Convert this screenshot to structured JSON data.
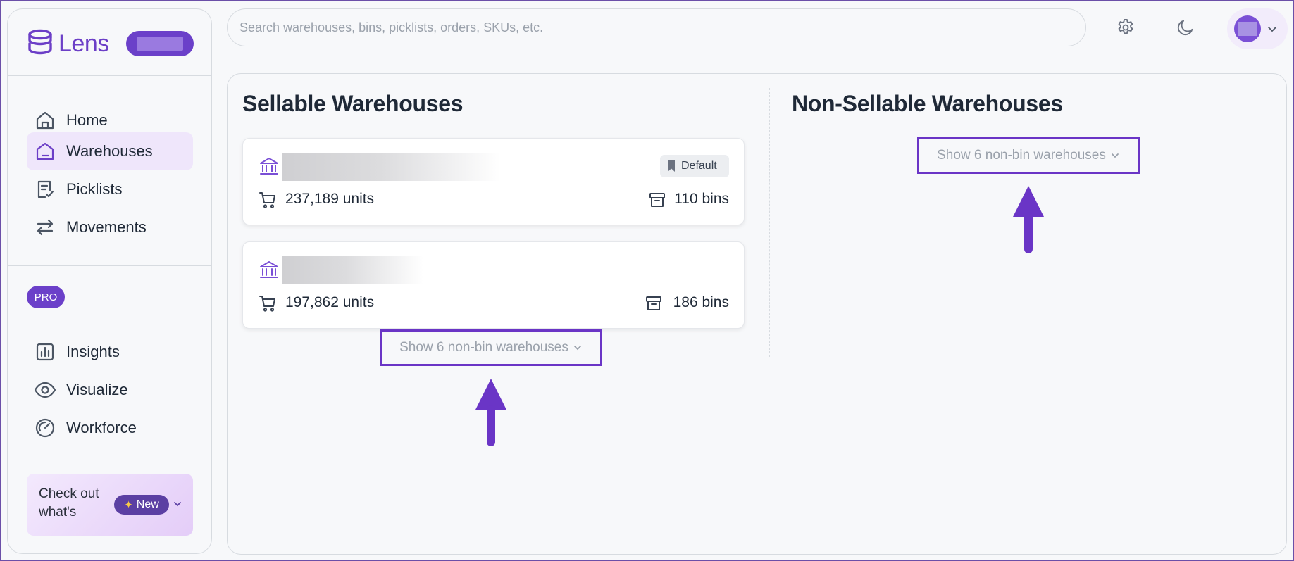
{
  "app": {
    "name": "Lens",
    "accent": "#6b40c9"
  },
  "sidebar": {
    "items": [
      {
        "label": "Home",
        "icon": "home-icon",
        "active": false
      },
      {
        "label": "Warehouses",
        "icon": "warehouse-icon",
        "active": true
      },
      {
        "label": "Picklists",
        "icon": "picklist-icon",
        "active": false
      },
      {
        "label": "Movements",
        "icon": "arrows-swap-icon",
        "active": false
      }
    ],
    "pro_badge": "PRO",
    "pro_items": [
      {
        "label": "Insights",
        "icon": "bar-chart-icon"
      },
      {
        "label": "Visualize",
        "icon": "eye-icon"
      },
      {
        "label": "Workforce",
        "icon": "gauge-icon"
      }
    ],
    "promo": {
      "text": "Check out what's",
      "pill": "New",
      "pill_icon": "sparkle-icon"
    }
  },
  "topbar": {
    "search_placeholder": "Search warehouses, bins, picklists, orders, SKUs, etc.",
    "icons": [
      "gear-icon",
      "moon-icon",
      "chevron-down-icon"
    ]
  },
  "sellable": {
    "title": "Sellable Warehouses",
    "cards": [
      {
        "units": "237,189 units",
        "bins": "110 bins",
        "badge": "Default"
      },
      {
        "units": "197,862 units",
        "bins": "186 bins",
        "badge": ""
      }
    ],
    "show_more": "Show 6 non-bin warehouses"
  },
  "non_sellable": {
    "title": "Non-Sellable Warehouses",
    "show_more": "Show 6 non-bin warehouses"
  },
  "annotation_color": "#6a35c6"
}
